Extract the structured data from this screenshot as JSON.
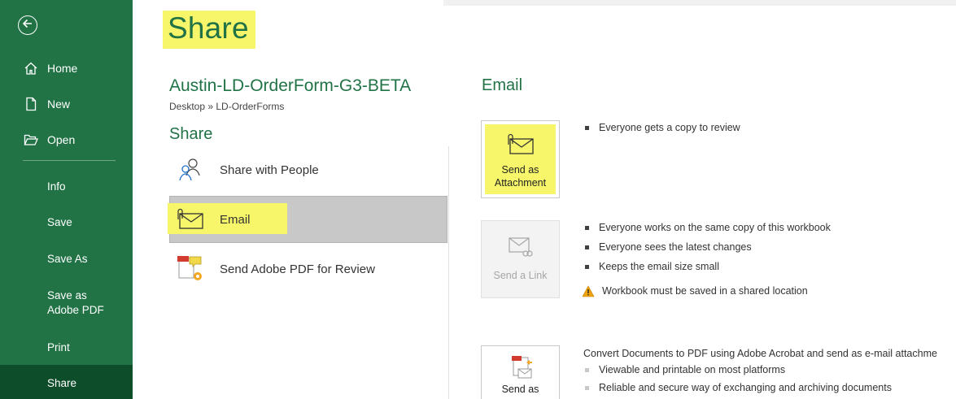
{
  "sidebar": {
    "back_icon": "back-arrow-icon",
    "top_items": [
      {
        "label": "Home",
        "icon": "home-icon"
      },
      {
        "label": "New",
        "icon": "new-document-icon"
      },
      {
        "label": "Open",
        "icon": "open-folder-icon"
      }
    ],
    "items": [
      {
        "label": "Info"
      },
      {
        "label": "Save"
      },
      {
        "label": "Save As"
      },
      {
        "label": "Save as Adobe PDF"
      },
      {
        "label": "Print"
      },
      {
        "label": "Share",
        "active": true
      }
    ]
  },
  "page": {
    "title": "Share"
  },
  "document": {
    "name": "Austin-LD-OrderForm-G3-BETA",
    "path": "Desktop » LD-OrderForms"
  },
  "share": {
    "heading": "Share",
    "options": [
      {
        "label": "Share with People",
        "icon": "people-icon"
      },
      {
        "label": "Email",
        "icon": "email-attachment-icon",
        "selected": true
      },
      {
        "label": "Send Adobe PDF for Review",
        "icon": "adobe-pdf-review-icon"
      }
    ]
  },
  "email": {
    "heading": "Email",
    "attachment": {
      "label_line1": "Send as",
      "label_line2": "Attachment",
      "bullets": [
        "Everyone gets a copy to review"
      ]
    },
    "link": {
      "label": "Send a Link",
      "bullets": [
        "Everyone works on the same copy of this workbook",
        "Everyone sees the latest changes",
        "Keeps the email size small"
      ],
      "warning": "Workbook must be saved in a shared location"
    },
    "pdf": {
      "label": "Send as",
      "text": "Convert Documents to PDF using Adobe Acrobat and send as e-mail attachme",
      "bullets": [
        "Viewable and printable on most platforms",
        "Reliable and secure way of exchanging and archiving documents"
      ]
    }
  },
  "colors": {
    "brand": "#217346",
    "brand_dark": "#0e4d2a",
    "highlight": "#f7f66a",
    "selected_bg": "#c8c8c8"
  }
}
